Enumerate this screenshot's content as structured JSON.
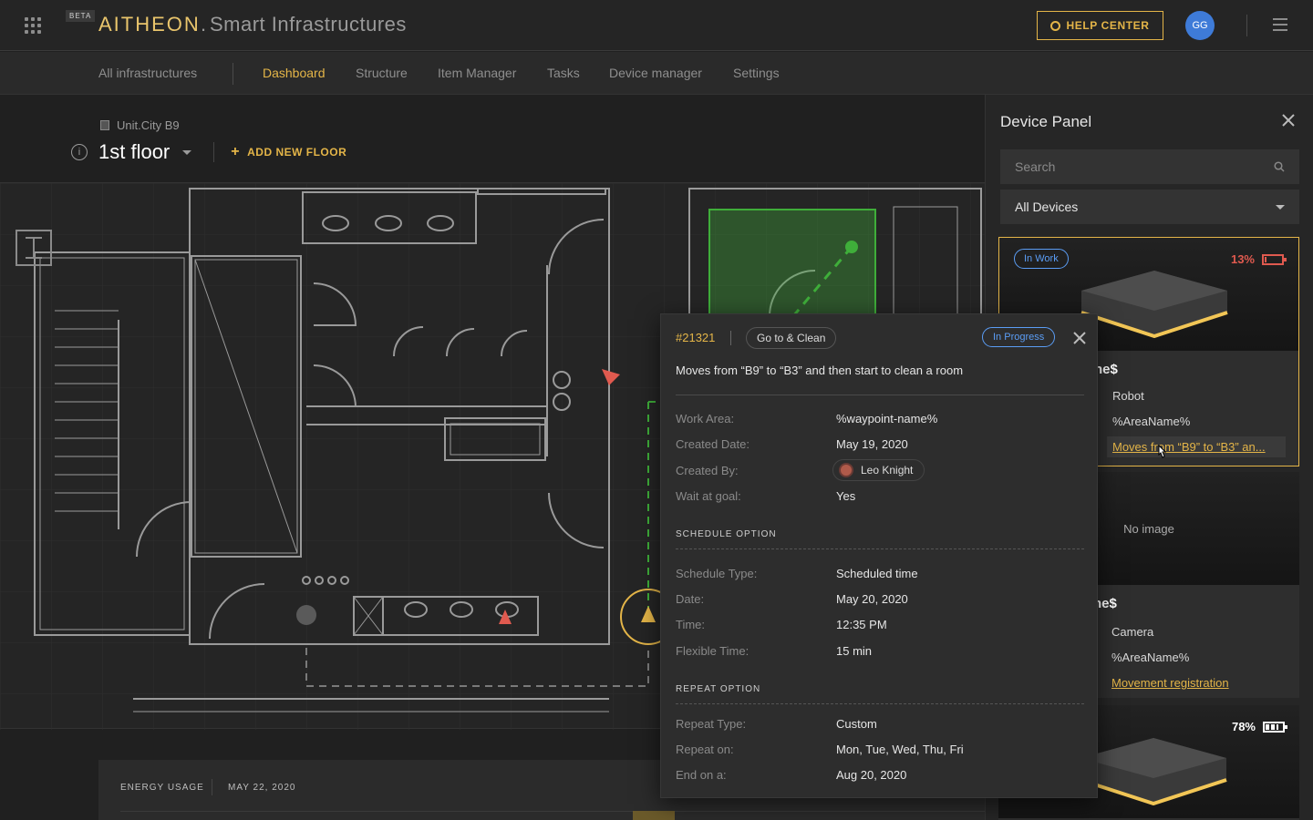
{
  "header": {
    "beta": "BETA",
    "logo": "AITHEON",
    "logo_sep": ".",
    "app_title": "Smart Infrastructures",
    "help": "HELP CENTER",
    "avatar": "GG"
  },
  "subnav": {
    "items": [
      "All infrastructures",
      "Dashboard",
      "Structure",
      "Item Manager",
      "Tasks",
      "Device manager",
      "Settings"
    ],
    "active": "Dashboard"
  },
  "main": {
    "building": "Unit.City B9",
    "info_glyph": "i",
    "floor": "1st floor",
    "add_floor": "ADD NEW FLOOR"
  },
  "energy": {
    "label": "ENERGY USAGE",
    "date": "MAY 22, 2020"
  },
  "panel": {
    "title": "Device Panel",
    "search_placeholder": "Search",
    "filter": "All Devices",
    "cards": [
      {
        "status": "In Work",
        "battery": "13%",
        "battery_level": 0.13,
        "battery_color": "#e05a4f",
        "name": "ne$",
        "type": "Robot",
        "area": "%AreaName%",
        "task": "Moves from “B9” to “B3” an..."
      },
      {
        "no_image": "No image",
        "name": "ne$",
        "type": "Camera",
        "area": "%AreaName%",
        "task": "Movement registration"
      },
      {
        "battery": "78%",
        "battery_level": 0.78,
        "battery_color": "#ffffff"
      }
    ]
  },
  "popup": {
    "id": "#21321",
    "tag": "Go to & Clean",
    "status": "In Progress",
    "desc": "Moves from “B9” to “B3” and then start to clean a room",
    "details": [
      {
        "k": "Work Area:",
        "v": "%waypoint-name%"
      },
      {
        "k": "Created Date:",
        "v": "May 19, 2020"
      },
      {
        "k": "Created By:",
        "v": "Leo Knight"
      },
      {
        "k": "Wait at goal:",
        "v": "Yes"
      }
    ],
    "schedule_title": "SCHEDULE OPTION",
    "schedule": [
      {
        "k": "Schedule Type:",
        "v": "Scheduled time"
      },
      {
        "k": "Date:",
        "v": "May 20, 2020"
      },
      {
        "k": "Time:",
        "v": "12:35 PM"
      },
      {
        "k": "Flexible Time:",
        "v": "15 min"
      }
    ],
    "repeat_title": "REPEAT OPTION",
    "repeat": [
      {
        "k": "Repeat Type:",
        "v": "Custom"
      },
      {
        "k": "Repeat on:",
        "v": "Mon, Tue, Wed, Thu, Fri"
      },
      {
        "k": "End on a:",
        "v": "Aug 20, 2020"
      }
    ]
  },
  "colors": {
    "accent": "#e4b548",
    "status_blue": "#5b9df5",
    "danger": "#e05a4f",
    "zone_green": "#3fae3a"
  },
  "icons": [
    "apps-grid-icon",
    "lifebuoy-icon",
    "list-icon",
    "building-icon",
    "info-icon",
    "plus-icon",
    "close-icon",
    "search-icon",
    "chevron-down-icon",
    "battery-icon",
    "stairs-icon",
    "robot-marker-icon",
    "cursor-icon"
  ]
}
